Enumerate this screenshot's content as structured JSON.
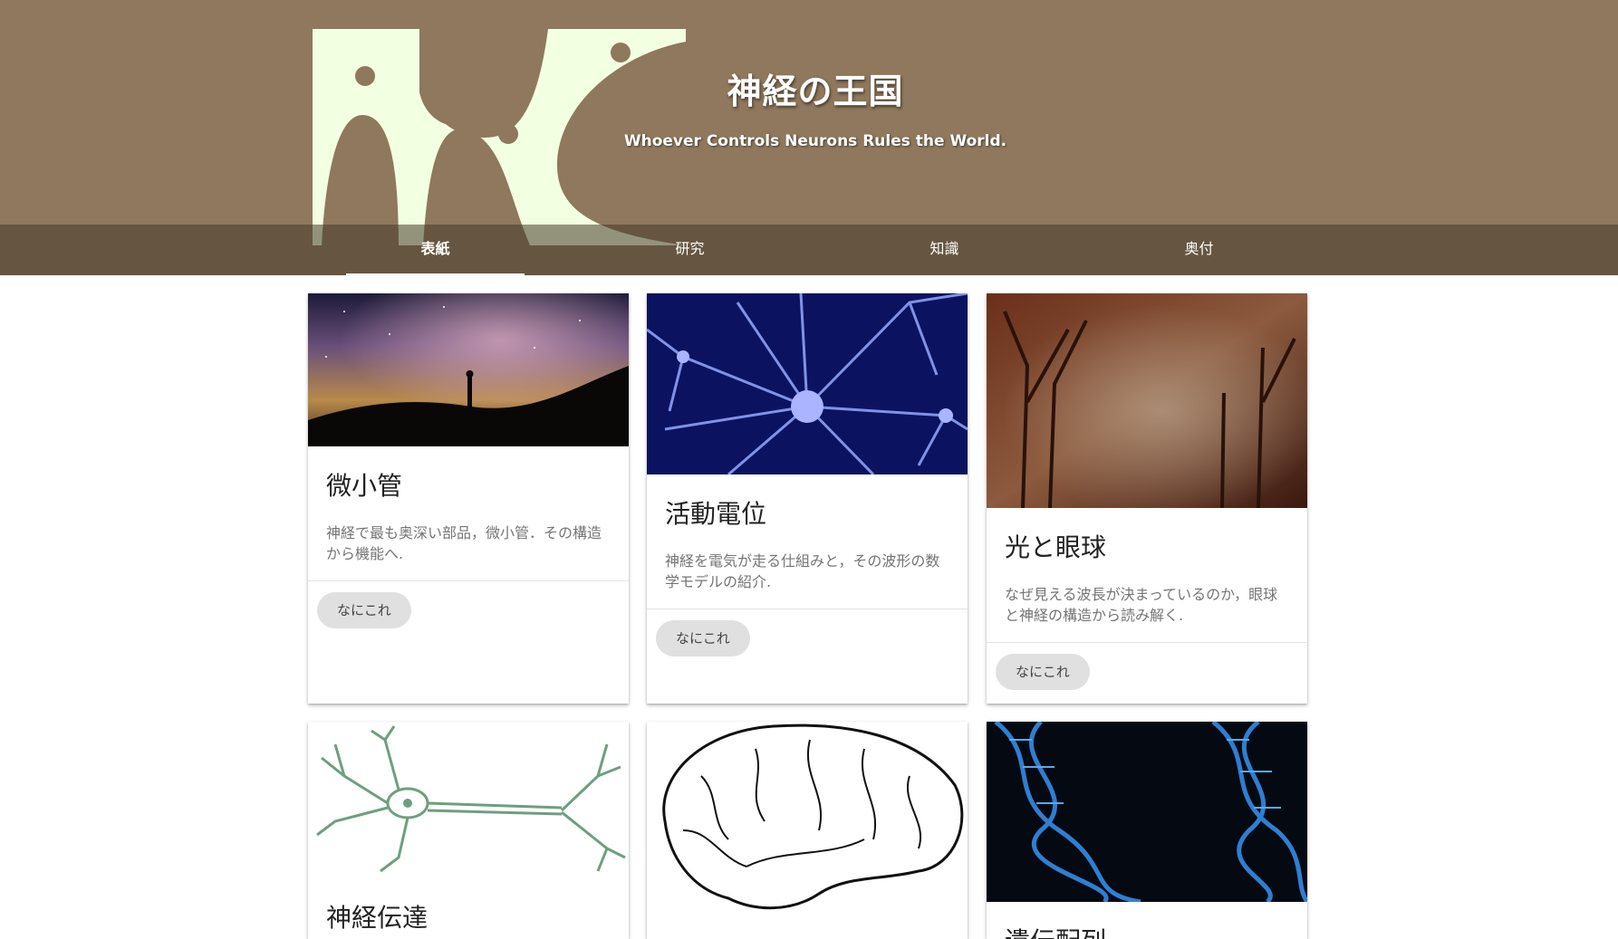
{
  "header": {
    "title": "神経の王国",
    "subtitle": "Whoever Controls Neurons Rules the World.",
    "logo_icon": "neuron-kingdom-logo",
    "background_color": "#8f785d",
    "logo_color": "#f2ffe0"
  },
  "tabs": [
    {
      "label": "表紙",
      "active": true
    },
    {
      "label": "研究",
      "active": false
    },
    {
      "label": "知識",
      "active": false
    },
    {
      "label": "奥付",
      "active": false
    }
  ],
  "cards": [
    {
      "title": "微小管",
      "description": "神経で最も奥深い部品，微小管．その構造から機能へ.",
      "button_label": "なにこれ",
      "image": "starry-sky-silhouette-image"
    },
    {
      "title": "活動電位",
      "description": "神経を電気が走る仕組みと，その波形の数学モデルの紹介.",
      "button_label": "なにこれ",
      "image": "blue-neuron-network-image"
    },
    {
      "title": "光と眼球",
      "description": "なぜ見える波長が決まっているのか，眼球と神経の構造から読み解く.",
      "button_label": "なにこれ",
      "image": "misty-forest-image"
    },
    {
      "title": "神経伝達",
      "image": "neuron-line-drawing-image"
    },
    {
      "title": "",
      "image": "brain-outline-image"
    },
    {
      "title": "遺伝配列",
      "image": "dna-helix-image"
    }
  ]
}
